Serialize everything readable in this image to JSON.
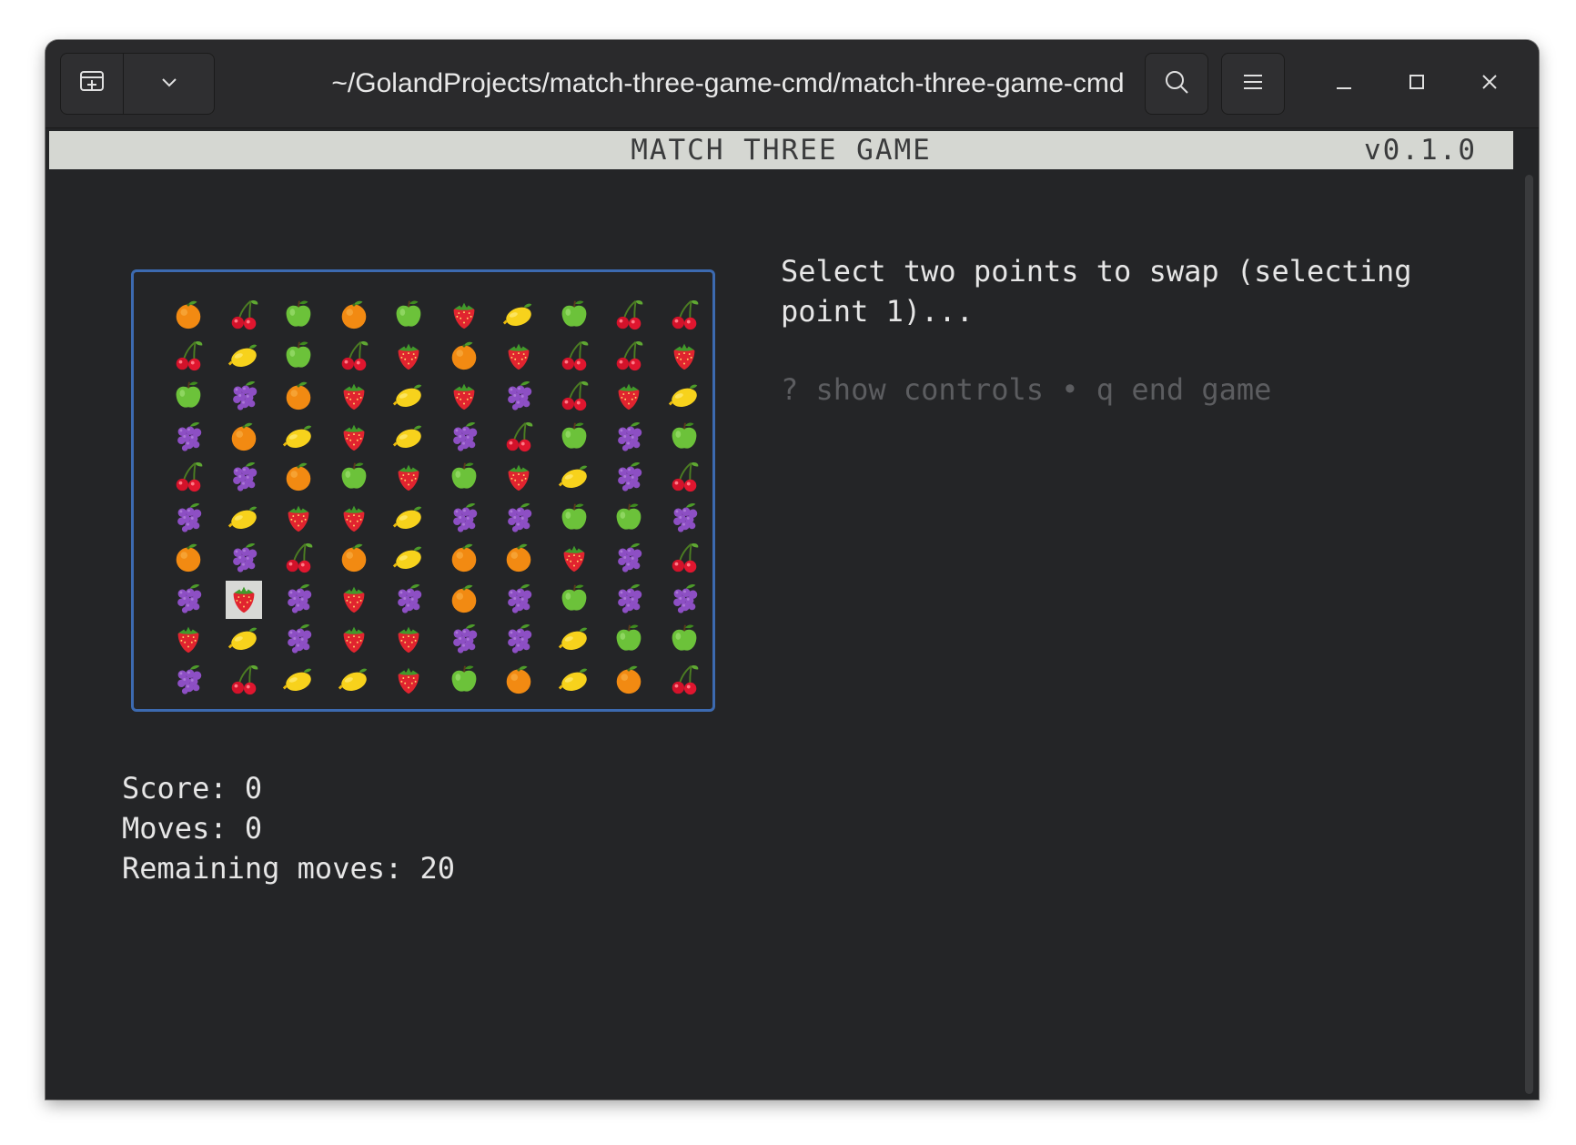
{
  "window": {
    "title": "~/GolandProjects/match-three-game-cmd/match-three-game-cmd"
  },
  "titlebar_icons": {
    "new_tab": "new-tab-icon",
    "dropdown": "chevron-down-icon",
    "search": "search-icon",
    "menu": "hamburger-menu-icon",
    "minimize": "minimize-icon",
    "maximize": "maximize-icon",
    "close": "close-icon"
  },
  "header": {
    "title": "MATCH THREE GAME",
    "version": "v0.1.0"
  },
  "board": {
    "selected_cell": {
      "row": 7,
      "col": 1
    },
    "rows": [
      [
        "orange",
        "cherry",
        "apple",
        "orange",
        "apple",
        "strawberry",
        "lemon",
        "apple",
        "cherry",
        "cherry"
      ],
      [
        "cherry",
        "lemon",
        "apple",
        "cherry",
        "strawberry",
        "orange",
        "strawberry",
        "cherry",
        "cherry",
        "strawberry"
      ],
      [
        "apple",
        "grapes",
        "orange",
        "strawberry",
        "lemon",
        "strawberry",
        "grapes",
        "cherry",
        "strawberry",
        "lemon"
      ],
      [
        "grapes",
        "orange",
        "lemon",
        "strawberry",
        "lemon",
        "grapes",
        "cherry",
        "apple",
        "grapes",
        "apple"
      ],
      [
        "cherry",
        "grapes",
        "orange",
        "apple",
        "strawberry",
        "apple",
        "strawberry",
        "lemon",
        "grapes",
        "cherry"
      ],
      [
        "grapes",
        "lemon",
        "strawberry",
        "strawberry",
        "lemon",
        "grapes",
        "grapes",
        "apple",
        "apple",
        "grapes"
      ],
      [
        "orange",
        "grapes",
        "cherry",
        "orange",
        "lemon",
        "orange",
        "orange",
        "strawberry",
        "grapes",
        "cherry"
      ],
      [
        "grapes",
        "strawberry",
        "grapes",
        "strawberry",
        "grapes",
        "orange",
        "grapes",
        "apple",
        "grapes",
        "grapes"
      ],
      [
        "strawberry",
        "lemon",
        "grapes",
        "strawberry",
        "strawberry",
        "grapes",
        "grapes",
        "lemon",
        "apple",
        "apple"
      ],
      [
        "grapes",
        "cherry",
        "lemon",
        "lemon",
        "strawberry",
        "apple",
        "orange",
        "lemon",
        "orange",
        "cherry"
      ]
    ]
  },
  "prompt": "Select two points to swap (selecting point 1)...",
  "help": "? show controls • q end game",
  "stats": {
    "score": "Score: 0",
    "moves": "Moves: 0",
    "remaining": "Remaining moves: 20"
  },
  "colors": {
    "board_border": "#3c6ab0",
    "header_bg": "#d5d7d2",
    "terminal_bg": "#242527"
  }
}
